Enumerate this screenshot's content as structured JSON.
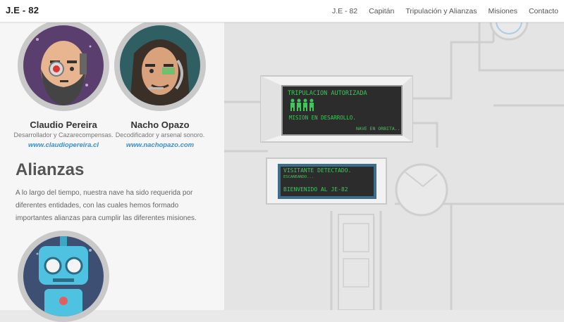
{
  "nav": {
    "brand": "J.E - 82",
    "items": [
      "J.E - 82",
      "Capitán",
      "Tripulación y Alianzas",
      "Misiones",
      "Contacto"
    ]
  },
  "crew": [
    {
      "name": "Claudio Pereira",
      "role": "Desarrollador y Cazarecompensas.",
      "site": "www.claudiopereira.cl"
    },
    {
      "name": "Nacho Opazo",
      "role": "Decodificador y arsenal sonoro.",
      "site": "www.nachopazo.com"
    }
  ],
  "alianzas": {
    "title": "Alianzas",
    "text": "A lo largo del tiempo, nuestra nave ha sido requerida por diferentes entidades, con las cuales hemos formado importantes alianzas para cumplir las diferentes misiones."
  },
  "screen1": {
    "line1": "TRIPULACION AUTORIZADA",
    "line2": "MISION EN DESARROLLO.",
    "line3": "NAVE EN ORBITA..."
  },
  "screen2": {
    "line1": "VISITANTE DETECTADO.",
    "line2": "ESCANEANDO...",
    "line3": "BIENVENIDO AL JE-82"
  },
  "colors": {
    "accent": "#3b8fd0",
    "screen_text": "#3cc85a",
    "screen_bg": "#2c2c2c"
  }
}
